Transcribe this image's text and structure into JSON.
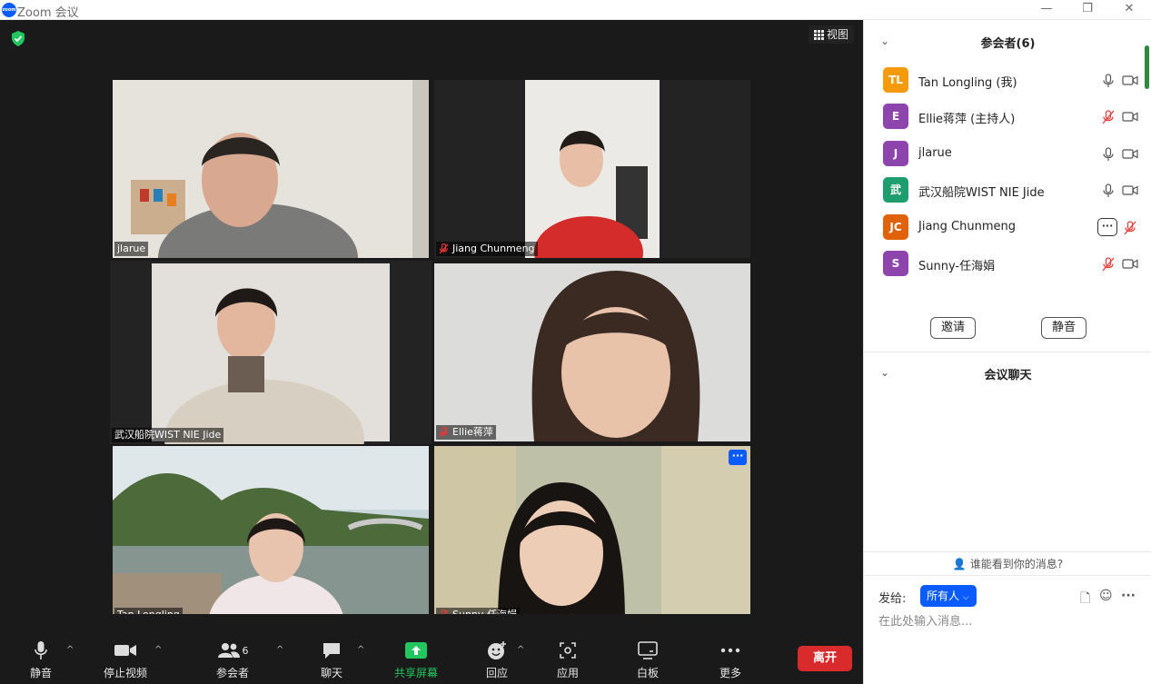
{
  "window": {
    "title": "Zoom 会议",
    "controls": [
      "—",
      "❐",
      "✕"
    ]
  },
  "stage": {
    "view_label": "视图",
    "tiles": [
      {
        "name": "jlarue",
        "muted": false,
        "active": false
      },
      {
        "name": "Jiang Chunmeng",
        "muted": true,
        "active": false
      },
      {
        "name": "武汉船院WIST NIE Jide",
        "muted": false,
        "active": true
      },
      {
        "name": "Ellie蒋萍",
        "muted": true,
        "active": false
      },
      {
        "name": "Tan Longling",
        "muted": false,
        "active": false
      },
      {
        "name": "Sunny-任海娟",
        "muted": true,
        "active": false
      }
    ],
    "tile_more_label": "···"
  },
  "toolbar": {
    "mute": "静音",
    "stop_video": "停止视频",
    "participants": "参会者",
    "participants_count": "6",
    "chat": "聊天",
    "share": "共享屏幕",
    "reactions": "回应",
    "apps": "应用",
    "whiteboard": "白板",
    "more": "更多",
    "leave": "离开"
  },
  "panel": {
    "participants_title": "参会者(6)",
    "participants": [
      {
        "initials": "TL",
        "name": "Tan Longling (我)",
        "color": "#f49a0c",
        "mic": "on",
        "cam": "off"
      },
      {
        "initials": "E",
        "name": "Ellie蒋萍 (主持人)",
        "color": "#8e44ad",
        "mic": "muted",
        "cam": "off"
      },
      {
        "initials": "J",
        "name": "jlarue",
        "color": "#8e44ad",
        "mic": "on",
        "cam": "off"
      },
      {
        "initials": "武",
        "name": "武汉船院WIST NIE Jide",
        "color": "#1e9e6f",
        "mic": "on",
        "cam": "off"
      },
      {
        "initials": "JC",
        "name": "Jiang Chunmeng",
        "color": "#e0620b",
        "mic": "muted",
        "cam": "none"
      },
      {
        "initials": "S",
        "name": "Sunny-任海娟",
        "color": "#8e44ad",
        "mic": "muted",
        "cam": "off"
      }
    ],
    "more_label": "···",
    "invite": "邀请",
    "mute_all": "静音",
    "chat_title": "会议聊天",
    "who_can_see": "谁能看到你的消息?",
    "send_to_label": "发给:",
    "send_to_value": "所有人",
    "input_placeholder": "在此处输入消息..."
  },
  "colors": {
    "stage_bg": "#1a1a1a",
    "accent": "#0b5cff",
    "leave": "#d92b2b",
    "share": "#22c55e",
    "active_border": "#d9e97c"
  }
}
